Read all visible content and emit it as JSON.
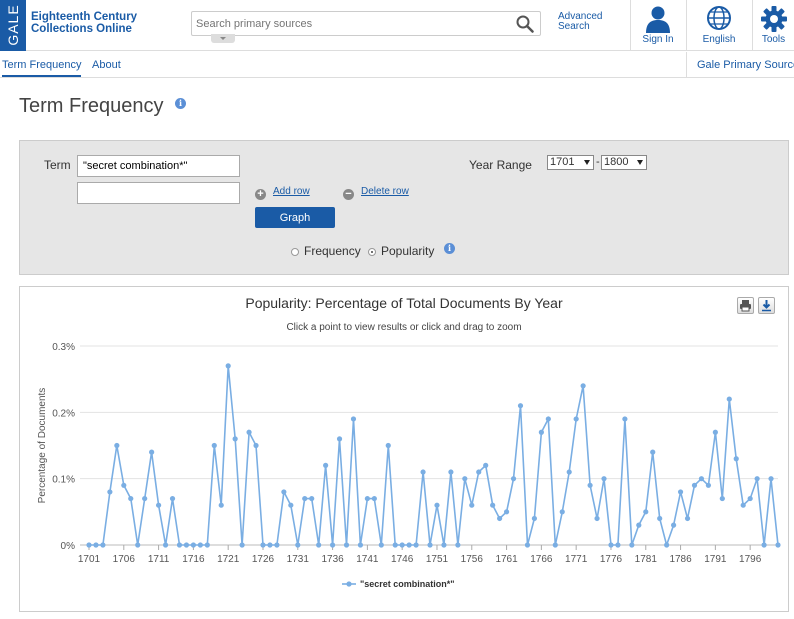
{
  "header": {
    "logo_text": "GALE",
    "product_name": "Eighteenth Century Collections Online",
    "search_placeholder": "Search primary sources",
    "advanced_search": "Advanced Search",
    "sign_in": "Sign In",
    "language": "English",
    "tools": "Tools"
  },
  "subnav": {
    "items": [
      "Term Frequency",
      "About"
    ],
    "right_link": "Gale Primary Sources"
  },
  "page": {
    "title": "Term Frequency"
  },
  "form": {
    "term_label": "Term",
    "term1_value": "\"secret combination*\"",
    "term2_value": "",
    "add_row": "Add row",
    "delete_row": "Delete row",
    "graph_button": "Graph",
    "radio_frequency": "Frequency",
    "radio_popularity": "Popularity",
    "selected_mode": "Popularity",
    "year_range_label": "Year Range",
    "year_from": "1701",
    "year_to": "1800",
    "year_separator": "-"
  },
  "colors": {
    "brand": "#1a5ba6",
    "series": "#7aaee3",
    "panel_bg": "#e6e6e6"
  },
  "chart_data": {
    "type": "line",
    "title": "Popularity: Percentage of Total Documents By Year",
    "subtitle": "Click a point to view results or click and drag to zoom",
    "ylabel": "Percentage of Documents",
    "xlabel": "",
    "ylim": [
      0,
      0.3
    ],
    "yticks": [
      "0%",
      "0.1%",
      "0.2%",
      "0.3%"
    ],
    "x_start": 1701,
    "x_end": 1800,
    "xticks": [
      "1701",
      "1706",
      "1711",
      "1716",
      "1721",
      "1726",
      "1731",
      "1736",
      "1741",
      "1746",
      "1751",
      "1756",
      "1761",
      "1766",
      "1771",
      "1776",
      "1781",
      "1786",
      "1791",
      "1796"
    ],
    "legend_position": "bottom-center",
    "grid": true,
    "series": [
      {
        "name": "\"secret combination*\"",
        "values": [
          0,
          0,
          0,
          0.08,
          0.15,
          0.09,
          0.07,
          0,
          0.07,
          0.14,
          0.06,
          0,
          0.07,
          0,
          0,
          0,
          0,
          0,
          0.15,
          0.06,
          0.27,
          0.16,
          0,
          0.17,
          0.15,
          0,
          0,
          0,
          0.08,
          0.06,
          0,
          0.07,
          0.07,
          0,
          0.12,
          0,
          0.16,
          0,
          0.19,
          0,
          0.07,
          0.07,
          0,
          0.15,
          0,
          0,
          0,
          0,
          0.11,
          0,
          0.06,
          0,
          0.11,
          0,
          0.1,
          0.06,
          0.11,
          0.12,
          0.06,
          0.04,
          0.05,
          0.1,
          0.21,
          0,
          0.04,
          0.17,
          0.19,
          0,
          0.05,
          0.11,
          0.19,
          0.24,
          0.09,
          0.04,
          0.1,
          0,
          0,
          0.19,
          0,
          0.03,
          0.05,
          0.14,
          0.04,
          0,
          0.03,
          0.08,
          0.04,
          0.09,
          0.1,
          0.09,
          0.17,
          0.07,
          0.22,
          0.13,
          0.06,
          0.07,
          0.1,
          0,
          0.1,
          0
        ]
      }
    ]
  }
}
